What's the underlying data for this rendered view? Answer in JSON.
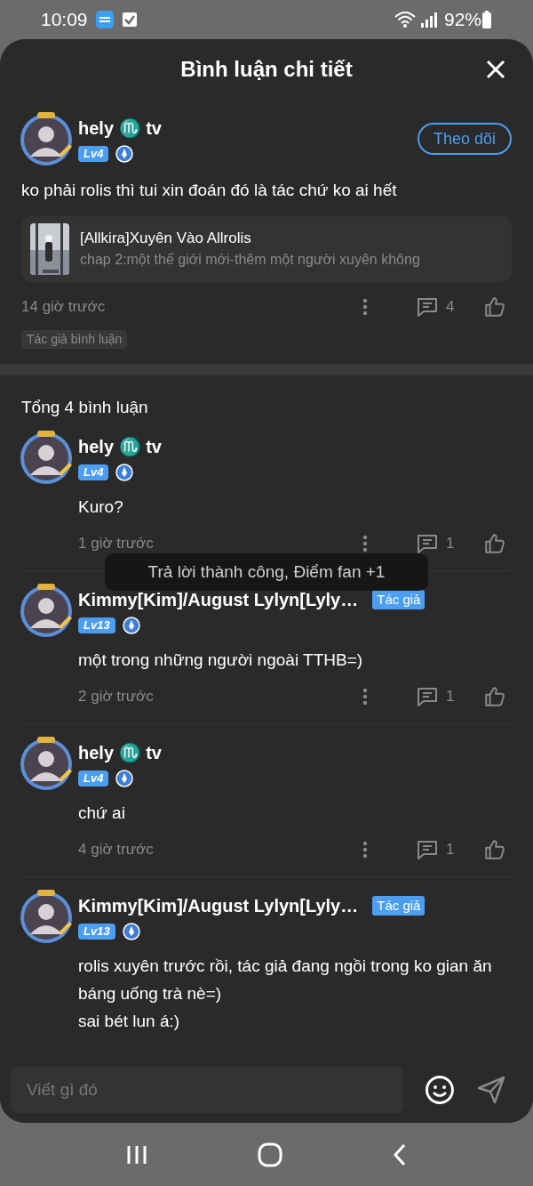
{
  "status_bar": {
    "time": "10:09",
    "battery": "92%"
  },
  "header": {
    "title": "Bình luận chi tiết"
  },
  "comment": {
    "name": "hely ♏ tv",
    "level": "Lv4",
    "follow_button": "Theo dõi",
    "text": "ko phải rolis thì tui xin đoán đó là tác chứ ko ai hết",
    "work": {
      "title": "[Allkira]Xuyên Vào Allrolis",
      "chapter": "chap 2:một thế giới mới-thêm một người xuyên không"
    },
    "time": "14 giờ trước",
    "reply_count": "4",
    "tag": "Tác giả bình luận"
  },
  "replies_header": "Tổng 4 bình luận",
  "replies": [
    {
      "name": "hely ♏ tv",
      "level": "Lv4",
      "text": "Kuro?",
      "time": "1 giờ trước",
      "reply_count": "1"
    },
    {
      "name": "Kimmy[Kim]/August Lylyn[Lyly…",
      "author_badge": "Tác giả",
      "level": "Lv13",
      "text": "một trong những người ngoài TTHB=)",
      "time": "2 giờ trước",
      "reply_count": "1"
    },
    {
      "name": "hely ♏ tv",
      "level": "Lv4",
      "text": "chứ ai",
      "time": "4 giờ trước",
      "reply_count": "1"
    },
    {
      "name": "Kimmy[Kim]/August Lylyn[Lyly…",
      "author_badge": "Tác giả",
      "level": "Lv13",
      "text": "rolis xuyên trước rồi, tác giả đang ngồi trong ko gian ăn báng uống trà nè=)\nsai bét lun á:)"
    }
  ],
  "toast": "Trả lời thành công, Điểm fan +1",
  "input": {
    "placeholder": "Viết gì đó"
  }
}
